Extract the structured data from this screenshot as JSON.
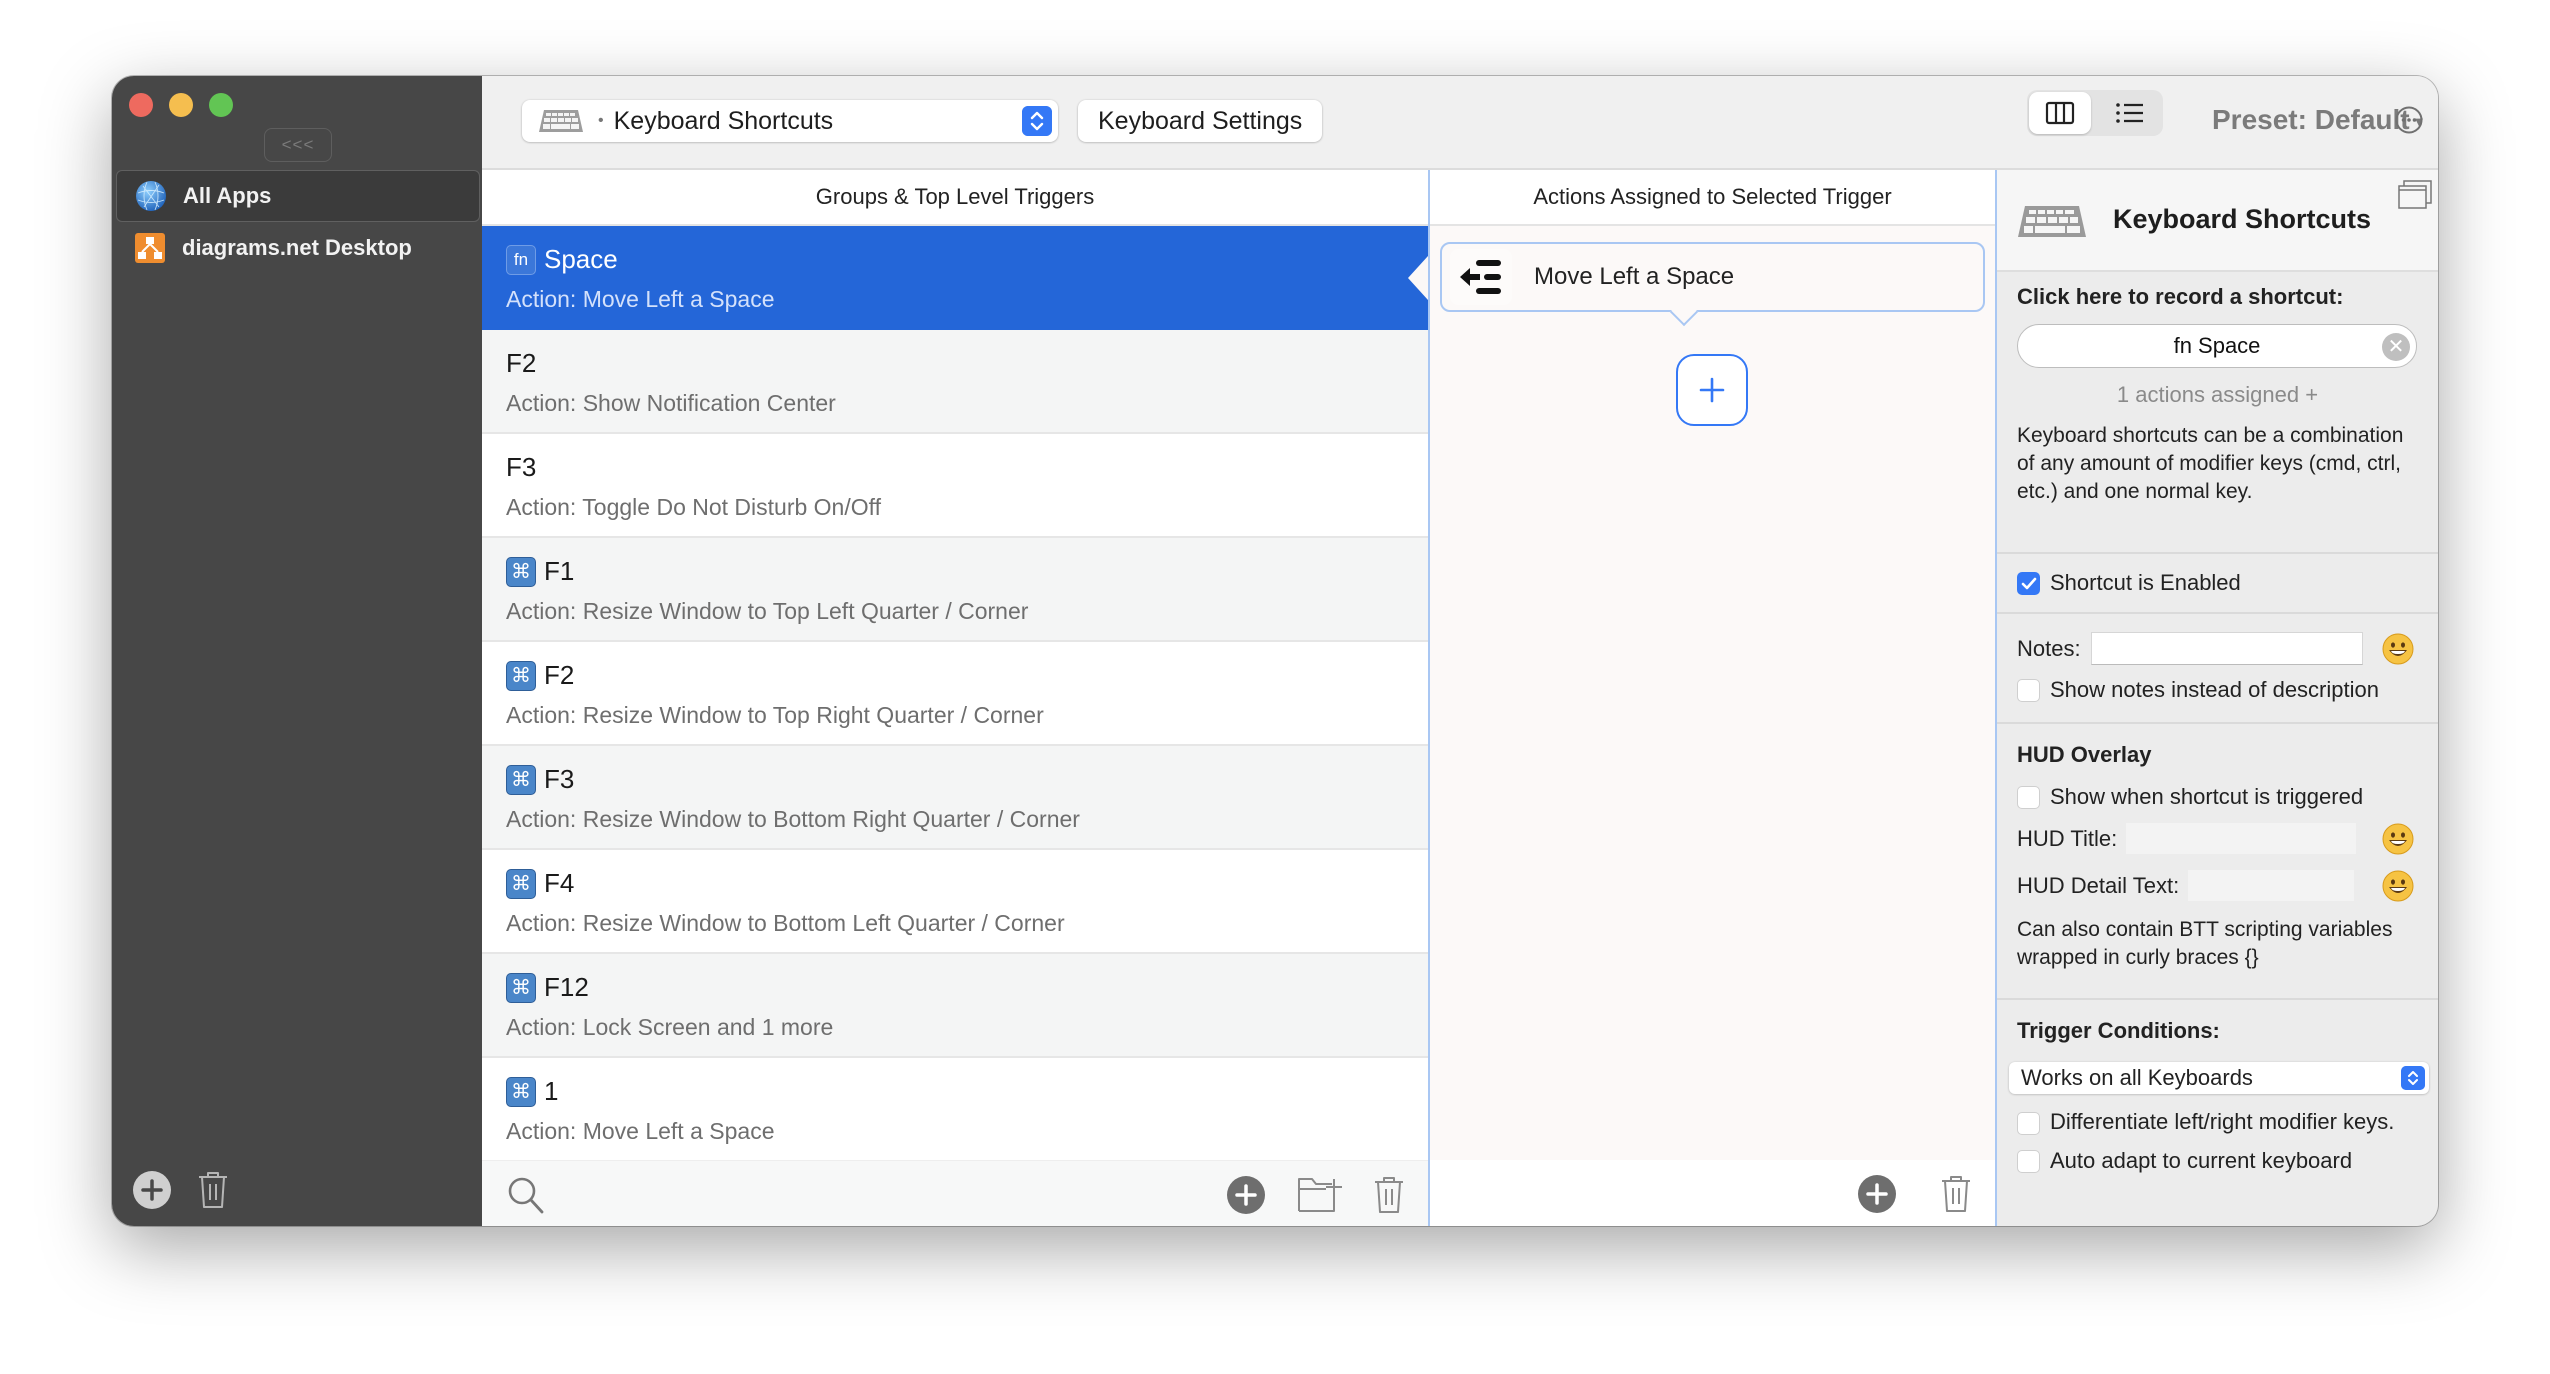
{
  "window": {
    "traffic_lights": [
      "close",
      "minimize",
      "zoom"
    ]
  },
  "sidebar": {
    "collapse_label": "<<<",
    "apps": [
      {
        "label": "All Apps",
        "icon": "globe-icon",
        "selected": true
      },
      {
        "label": "diagrams.net Desktop",
        "icon": "diagrams-app-icon",
        "selected": false
      }
    ],
    "footer": {
      "add_icon": "plus-circle-icon",
      "delete_icon": "trash-icon"
    }
  },
  "toolbar": {
    "trigger_type_select": {
      "icon": "keyboard-icon",
      "value": "Keyboard Shortcuts"
    },
    "keyboard_settings_label": "Keyboard Settings",
    "view_modes": [
      {
        "icon": "columns-icon",
        "active": true
      },
      {
        "icon": "list-icon",
        "active": false
      }
    ],
    "preset_label": "Preset: Default",
    "preset_caret": "▾",
    "more_icon": "ellipsis-circle-icon"
  },
  "triggers": {
    "header": "Groups & Top Level Triggers",
    "items": [
      {
        "modifier": "fn",
        "key": "Space",
        "action": "Action: Move Left a Space",
        "selected": true
      },
      {
        "modifier": "",
        "key": "F2",
        "action": "Action: Show Notification Center",
        "selected": false
      },
      {
        "modifier": "",
        "key": "F3",
        "action": "Action: Toggle Do Not Disturb On/Off",
        "selected": false
      },
      {
        "modifier": "⌘",
        "key": "F1",
        "action": "Action: Resize Window to Top Left Quarter / Corner",
        "selected": false
      },
      {
        "modifier": "⌘",
        "key": "F2",
        "action": "Action: Resize Window to Top Right Quarter / Corner",
        "selected": false
      },
      {
        "modifier": "⌘",
        "key": "F3",
        "action": "Action: Resize Window to Bottom Right Quarter / Corner",
        "selected": false
      },
      {
        "modifier": "⌘",
        "key": "F4",
        "action": "Action: Resize Window to Bottom Left Quarter / Corner",
        "selected": false
      },
      {
        "modifier": "⌘",
        "key": "F12",
        "action": "Action: Lock Screen and 1 more",
        "selected": false
      },
      {
        "modifier": "⌘",
        "key": "1",
        "action": "Action: Move Left a Space",
        "selected": false
      }
    ],
    "footer": {
      "search_icon": "search-icon",
      "add_icon": "plus-circle-icon",
      "new_folder_icon": "folder-plus-icon",
      "delete_icon": "trash-icon"
    }
  },
  "actions": {
    "header": "Actions Assigned to Selected Trigger",
    "items": [
      {
        "label": "Move Left a Space",
        "icon": "move-left-space-icon"
      }
    ],
    "add_label": "+",
    "footer": {
      "add_icon": "plus-circle-icon",
      "delete_icon": "trash-icon"
    }
  },
  "inspector": {
    "title": "Keyboard Shortcuts",
    "record_label": "Click here to record a shortcut:",
    "shortcut_value": "fn Space",
    "clear_icon": "✕",
    "actions_assigned": "1 actions assigned +",
    "description": "Keyboard shortcuts can be a combination of any amount of modifier keys (cmd, ctrl, etc.) and one normal key.",
    "enabled_label": "Shortcut is Enabled",
    "enabled": true,
    "notes_label": "Notes:",
    "notes_value": "",
    "show_notes_label": "Show notes instead of description",
    "show_notes": false,
    "hud_heading": "HUD Overlay",
    "hud_show_label": "Show when shortcut is triggered",
    "hud_show": false,
    "hud_title_label": "HUD Title:",
    "hud_title_value": "",
    "hud_detail_label": "HUD Detail Text:",
    "hud_detail_value": "",
    "hud_note": "Can also contain BTT scripting variables wrapped in curly braces {}",
    "conditions_heading": "Trigger Conditions:",
    "keyboard_select_value": "Works on all Keyboards",
    "differentiate_label": "Differentiate left/right modifier keys.",
    "differentiate": false,
    "auto_adapt_label": "Auto adapt to current keyboard",
    "auto_adapt": false
  },
  "colors": {
    "accent": "#3478f6",
    "selection": "#2466d8",
    "sidebar_bg": "#474747",
    "modifier_badge": "#4a86c9"
  }
}
